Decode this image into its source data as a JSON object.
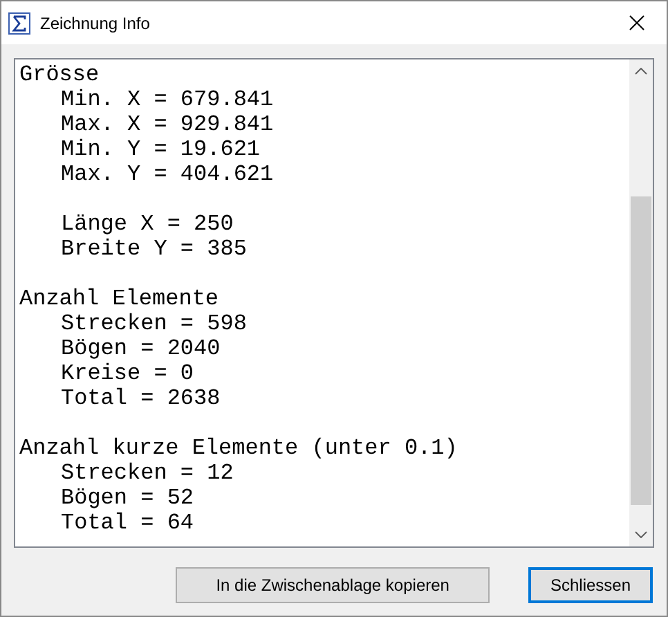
{
  "window": {
    "title": "Zeichnung Info"
  },
  "sections": [
    {
      "title": "Grösse",
      "groups": [
        [
          "Min. X = 679.841",
          "Max. X = 929.841",
          "Min. Y = 19.621",
          "Max. Y = 404.621"
        ],
        [
          "Länge X = 250",
          "Breite Y = 385"
        ]
      ]
    },
    {
      "title": "Anzahl Elemente",
      "groups": [
        [
          "Strecken = 598",
          "Bögen = 2040",
          "Kreise = 0",
          "Total = 2638"
        ]
      ]
    },
    {
      "title": "Anzahl kurze Elemente (unter 0.1)",
      "groups": [
        [
          "Strecken = 12",
          "Bögen = 52",
          "Total = 64"
        ]
      ]
    }
  ],
  "buttons": [
    {
      "label": "In die Zwischenablage kopieren",
      "selected": false
    },
    {
      "label": "Schliessen",
      "selected": true
    }
  ]
}
